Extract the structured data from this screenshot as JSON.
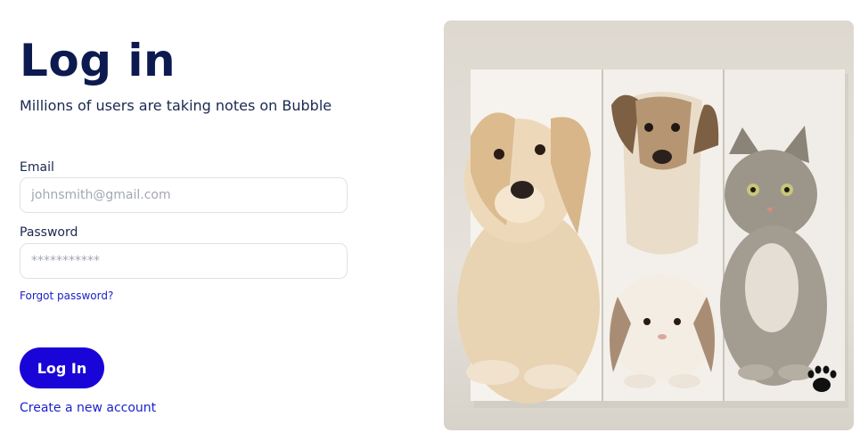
{
  "login": {
    "title": "Log in",
    "subtitle": "Millions of users are taking notes on Bubble",
    "email_label": "Email",
    "email_placeholder": "johnsmith@gmail.com",
    "password_label": "Password",
    "password_placeholder": "***********",
    "forgot_label": "Forgot password?",
    "submit_label": "Log In",
    "create_label": "Create a new account"
  },
  "hero": {
    "icon": "paw-icon",
    "colors": {
      "panel": "#e6e2db",
      "button": "#1a05d8",
      "link": "#1b22c9"
    }
  }
}
